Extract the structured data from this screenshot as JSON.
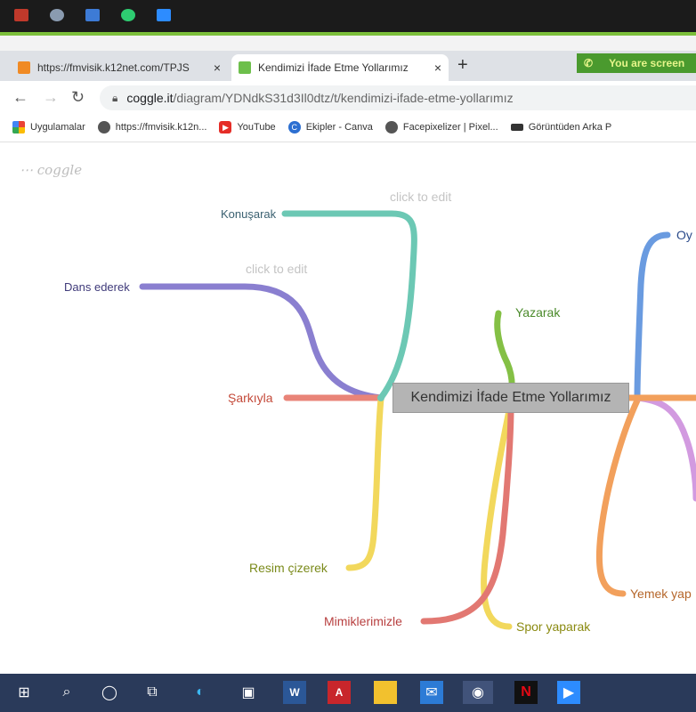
{
  "colors": {
    "teal": "#6cc8b4",
    "purple": "#8a7fd0",
    "coral": "#e98478",
    "yellow": "#f2d85c",
    "green": "#84c045",
    "red": "#e27872",
    "blue": "#6a9be0",
    "orange": "#f2a05c",
    "lilac": "#d29ae0",
    "central_bg": "#b4b4b4"
  },
  "tabs": [
    {
      "title": "https://fmvisik.k12net.com/TPJS",
      "favicon": "orange-app-icon",
      "close": "×"
    },
    {
      "title": "Kendimizi İfade Etme Yollarımız",
      "favicon": "coggle-icon",
      "close": "×"
    }
  ],
  "new_tab": "+",
  "screenshare_notice": "You are screen",
  "address": {
    "domain": "coggle.it",
    "path": "/diagram/YDNdkS31d3Il0dtz/t/kendimizi-ifade-etme-yollarımız"
  },
  "bookmarks": [
    {
      "label": "Uygulamalar",
      "icon": "apps-grid-icon"
    },
    {
      "label": "https://fmvisik.k12n...",
      "icon": "globe-icon"
    },
    {
      "label": "YouTube",
      "icon": "youtube-icon"
    },
    {
      "label": "Ekipler - Canva",
      "icon": "canva-icon"
    },
    {
      "label": "Facepixelizer | Pixel...",
      "icon": "globe-icon"
    },
    {
      "label": "Görüntüden Arka P",
      "icon": "hat-icon"
    }
  ],
  "mindmap": {
    "logo": "coggle",
    "central": "Kendimizi İfade Etme Yollarımız",
    "hints": [
      "click to edit",
      "click to edit"
    ],
    "branches": {
      "konusarak": "Konuşarak",
      "dans": "Dans ederek",
      "sarkiyla": "Şarkıyla",
      "resim": "Resim çizerek",
      "mimik": "Mimiklerimizle",
      "spor": "Spor yaparak",
      "yazarak": "Yazarak",
      "oyun": "Oy",
      "yemek": "Yemek yap"
    }
  }
}
